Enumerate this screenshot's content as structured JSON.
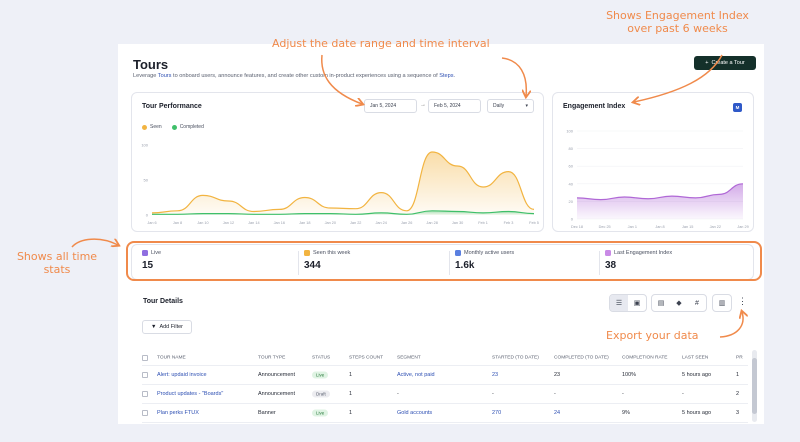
{
  "page": {
    "title": "Tours",
    "subtitle_pre": "Leverage ",
    "subtitle_link1": "Tours",
    "subtitle_mid": " to onboard users, announce features, and create other custom in-product experiences using a sequence of ",
    "subtitle_link2": "Steps",
    "subtitle_post": ".",
    "create_button": "Create a Tour"
  },
  "performance": {
    "title": "Tour Performance",
    "start_date": "Jan 5, 2024",
    "end_date": "Feb 5, 2024",
    "interval": "Daily",
    "legend": [
      {
        "label": "Seen",
        "color": "#f2b441"
      },
      {
        "label": "Completed",
        "color": "#3fbf6a"
      }
    ]
  },
  "engagement": {
    "title": "Engagement Index",
    "badge": "M"
  },
  "chart_data": [
    {
      "type": "area",
      "title": "Tour Performance",
      "x": [
        "Jan 6",
        "Jan 8",
        "Jan 10",
        "Jan 12",
        "Jan 14",
        "Jan 16",
        "Jan 18",
        "Jan 20",
        "Jan 22",
        "Jan 24",
        "Jan 26",
        "Jan 28",
        "Jan 30",
        "Feb 1",
        "Feb 3",
        "Feb 5"
      ],
      "y_ticks": [
        "100",
        "50",
        "0"
      ],
      "ylim": [
        0,
        100
      ],
      "series": [
        {
          "name": "Seen",
          "color": "#f2b441",
          "values": [
            3,
            6,
            28,
            20,
            5,
            8,
            25,
            10,
            9,
            32,
            6,
            90,
            70,
            40,
            62,
            8
          ]
        },
        {
          "name": "Completed",
          "color": "#3fbf6a",
          "values": [
            1,
            1,
            2,
            2,
            1,
            1,
            2,
            2,
            1,
            3,
            1,
            6,
            5,
            3,
            5,
            2
          ]
        }
      ]
    },
    {
      "type": "area",
      "title": "Engagement Index",
      "x": [
        "Dec 18",
        "Dec 25",
        "Jan 1",
        "Jan 8",
        "Jan 15",
        "Jan 22",
        "Jan 29"
      ],
      "y_ticks": [
        "100",
        "80",
        "60",
        "40",
        "20",
        "0"
      ],
      "ylim": [
        0,
        100
      ],
      "series": [
        {
          "name": "Engagement Index",
          "color": "#b068d6",
          "values": [
            24,
            22,
            25,
            23,
            26,
            24,
            28,
            40
          ]
        }
      ]
    }
  ],
  "stats": [
    {
      "label": "Live",
      "value": "15",
      "color": "#8f6ee0"
    },
    {
      "label": "Seen this week",
      "value": "344",
      "color": "#f2b441"
    },
    {
      "label": "Monthly active users",
      "value": "1.6k",
      "color": "#5a7fe0"
    },
    {
      "label": "Last Engagement Index",
      "value": "38",
      "color": "#c98ae6"
    }
  ],
  "details": {
    "title": "Tour Details",
    "add_filter": "Add Filter",
    "columns": [
      "Tour name",
      "Tour type",
      "Status",
      "Steps count",
      "Segment",
      "Started (to date)",
      "Completed (to date)",
      "Completion rate",
      "Last seen",
      "Pr"
    ],
    "rows": [
      [
        "Alert: updaid invoice",
        "Announcement",
        "Live",
        "1",
        "Active, not paid",
        "23",
        "23",
        "100%",
        "5 hours ago",
        "1"
      ],
      [
        "Product updates - \"Boards\"",
        "Announcement",
        "Draft",
        "1",
        "-",
        "-",
        "-",
        "-",
        "-",
        "2"
      ],
      [
        "Plan perks FTUX",
        "Banner",
        "Live",
        "1",
        "Gold accounts",
        "270",
        "24",
        "9%",
        "5 hours ago",
        "3"
      ]
    ]
  },
  "annotations": {
    "date_range": "Adjust the date range and time interval",
    "engagement_line1": "Shows Engagement Index",
    "engagement_line2": "over past 6 weeks",
    "stats_line1": "Shows all time",
    "stats_line2": "stats",
    "export": "Export your data"
  }
}
